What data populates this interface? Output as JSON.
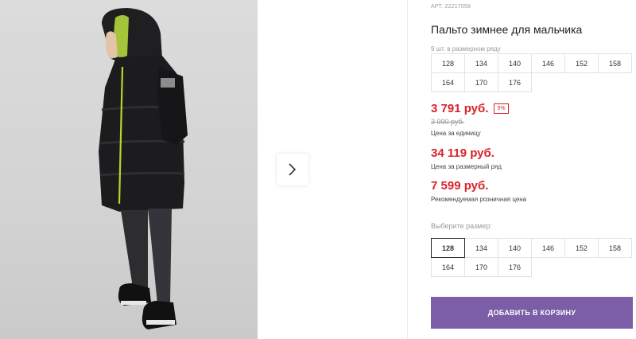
{
  "product": {
    "sku_label": "АРТ.",
    "sku_value": "22217058",
    "title": "Пальто зимнее для мальчика",
    "size_range_note": "9 шт. в размерном ряду"
  },
  "range_sizes": [
    [
      "128",
      "134",
      "140",
      "146",
      "152",
      "158"
    ],
    [
      "164",
      "170",
      "176"
    ]
  ],
  "prices": {
    "unit_price": "3 791 руб.",
    "discount": "5%",
    "old_price": "3 990 руб.",
    "unit_caption": "Цена за единицу",
    "set_price": "34 119 руб.",
    "set_caption": "Цена за размерный ряд",
    "rrp_price": "7 599 руб.",
    "rrp_caption": "Рекомендуемая розничная цена"
  },
  "size_select": {
    "label": "Выберите размер:",
    "selected": "128",
    "sizes": [
      [
        "128",
        "134",
        "140",
        "146",
        "152",
        "158"
      ],
      [
        "164",
        "170",
        "176"
      ]
    ]
  },
  "cart_button": "ДОБАВИТЬ В КОРЗИНУ",
  "colors": {
    "accent_purple": "#7b5ea7",
    "price_red": "#d8232a",
    "jacket": "#1c1c1e",
    "zip_lime": "#b8d430"
  },
  "gallery": {
    "next_icon": "chevron-right-icon"
  }
}
